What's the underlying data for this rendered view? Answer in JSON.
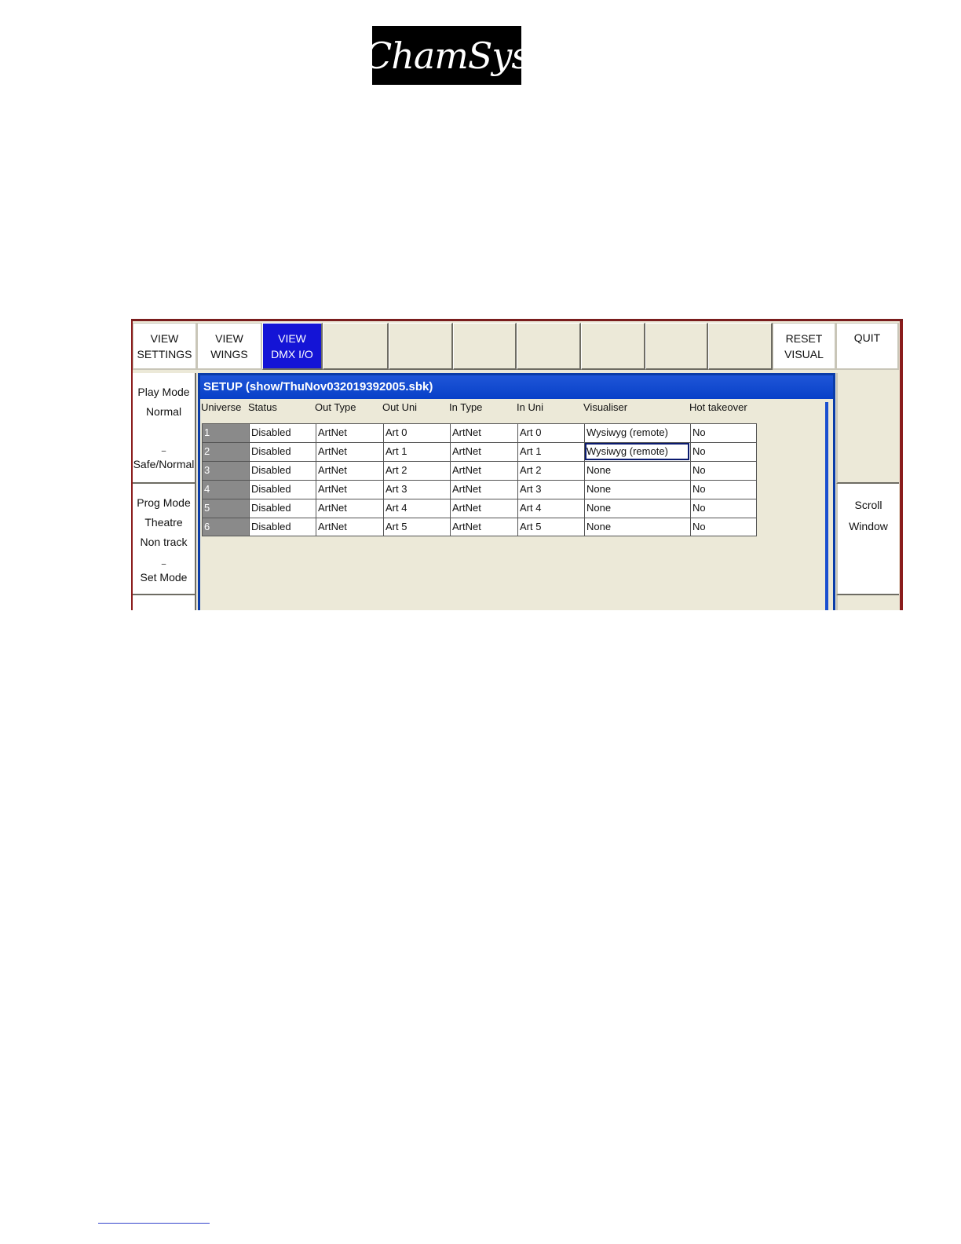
{
  "logo": {
    "text": "ChamSys"
  },
  "toolbar": {
    "view_settings": [
      "VIEW",
      "SETTINGS"
    ],
    "view_wings": [
      "VIEW",
      "WINGS"
    ],
    "view_dmx": [
      "VIEW",
      "DMX I/O"
    ],
    "reset_visual": [
      "RESET",
      "VISUAL"
    ],
    "quit": "QUIT"
  },
  "left_panel": {
    "play_mode_title": "Play Mode",
    "play_mode_value": "Normal",
    "play_mode_marker": "–",
    "play_mode_footer": "Safe/Normal",
    "prog_mode_title": "Prog Mode",
    "prog_mode_line1": "Theatre",
    "prog_mode_line2": "Non track",
    "prog_mode_marker": "–",
    "prog_mode_footer": "Set Mode"
  },
  "right_panel": {
    "scroll_line1": "Scroll",
    "scroll_line2": "Window"
  },
  "setup_window": {
    "title": "SETUP (show/ThuNov032019392005.sbk)",
    "columns": [
      "Universe",
      "Status",
      "Out Type",
      "Out Uni",
      "In Type",
      "In Uni",
      "Visualiser",
      "Hot takeover"
    ],
    "rows": [
      [
        "1",
        "Disabled",
        "ArtNet",
        "Art 0",
        "ArtNet",
        "Art 0",
        "Wysiwyg (remote)",
        "No"
      ],
      [
        "2",
        "Disabled",
        "ArtNet",
        "Art 1",
        "ArtNet",
        "Art 1",
        "Wysiwyg (remote)",
        "No"
      ],
      [
        "3",
        "Disabled",
        "ArtNet",
        "Art 2",
        "ArtNet",
        "Art 2",
        "None",
        "No"
      ],
      [
        "4",
        "Disabled",
        "ArtNet",
        "Art 3",
        "ArtNet",
        "Art 3",
        "None",
        "No"
      ],
      [
        "5",
        "Disabled",
        "ArtNet",
        "Art 4",
        "ArtNet",
        "Art 4",
        "None",
        "No"
      ],
      [
        "6",
        "Disabled",
        "ArtNet",
        "Art 5",
        "ArtNet",
        "Art 5",
        "None",
        "No"
      ]
    ],
    "selected_row": 1,
    "selected_col": 6
  },
  "colors": {
    "active_button": "#1414d6",
    "title_bar": "#0840c8",
    "universe_cell": "#8a8a8a"
  }
}
